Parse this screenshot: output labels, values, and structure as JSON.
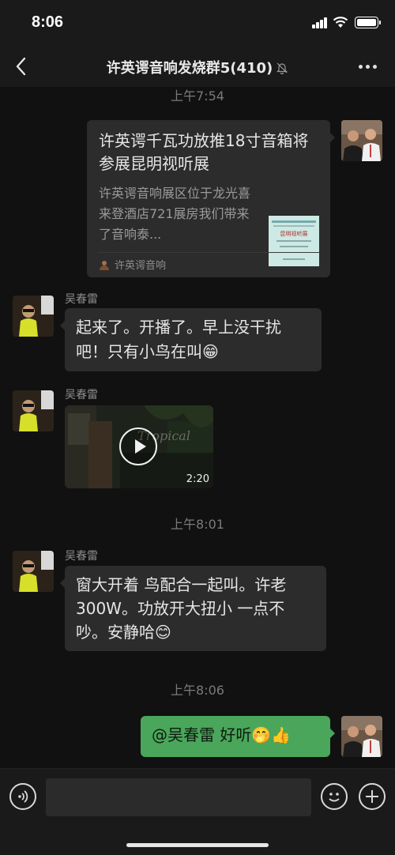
{
  "status": {
    "time": "8:06"
  },
  "header": {
    "title": "许英谔音响发烧群5(410)",
    "back_icon": "chevron-left-icon",
    "mute_icon": "bell-muted-icon",
    "more_icon": "more-dots-icon"
  },
  "timestamps": [
    "上午7:54",
    "上午8:01",
    "上午8:06"
  ],
  "messages": {
    "card": {
      "title": "许英谔千瓦功放推18寸音箱将参展昆明视听展",
      "description": "许英谔音响展区位于龙光喜来登酒店721展房我们带来了音响泰...",
      "source": "许英谔音响",
      "thumbnail_text": "昆明视听展"
    },
    "msg1": {
      "sender": "吴春雷",
      "text": "起来了。开播了。早上没干扰吧！只有小鸟在叫😁"
    },
    "msg2": {
      "sender": "吴春雷",
      "duration": "2:20",
      "overlay": "Tropical"
    },
    "msg3": {
      "sender": "吴春雷",
      "text": "窗大开着 鸟配合一起叫。许老300W。功放开大扭小 一点不吵。安静哈😊"
    },
    "msg4": {
      "text": "@吴春雷 好听🤭👍"
    }
  },
  "input": {
    "placeholder": ""
  },
  "colors": {
    "background": "#111111",
    "bubble": "#2c2c2c",
    "my_bubble": "#4aa65a",
    "bar": "#1a1a1a"
  }
}
